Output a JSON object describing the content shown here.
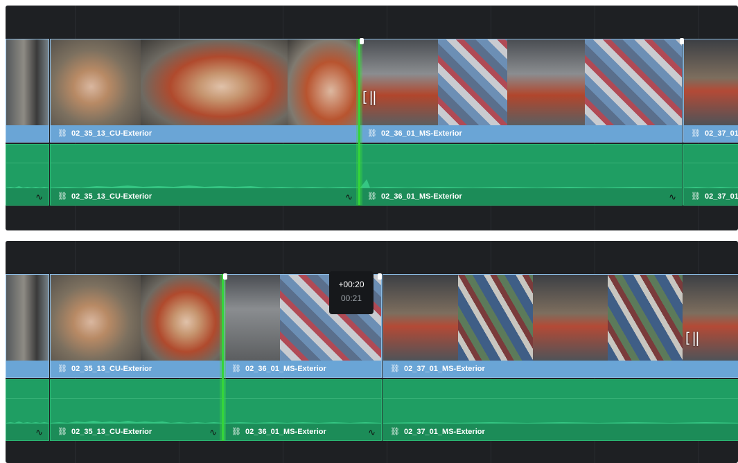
{
  "top_timeline": {
    "video_clips": [
      {
        "name": "",
        "link_icon": "link-icon"
      },
      {
        "name": "02_35_13_CU-Exterior",
        "link_icon": "link-icon"
      },
      {
        "name": "02_36_01_MS-Exterior",
        "link_icon": "link-icon"
      },
      {
        "name": "02_37_01",
        "link_icon": "link-icon"
      }
    ],
    "audio_clips": [
      {
        "name": "",
        "fade": "fade-curve-icon"
      },
      {
        "name": "02_35_13_CU-Exterior",
        "fade": "fade-curve-icon"
      },
      {
        "name": "02_36_01_MS-Exterior",
        "fade": "fade-curve-icon"
      },
      {
        "name": "02_37_01",
        "fade": "fade-curve-icon"
      }
    ],
    "cursor": "trim-cursor-icon"
  },
  "bottom_timeline": {
    "video_clips": [
      {
        "name": "",
        "link_icon": "link-icon"
      },
      {
        "name": "02_35_13_CU-Exterior",
        "link_icon": "link-icon"
      },
      {
        "name": "02_36_01_MS-Exterior",
        "link_icon": "link-icon"
      },
      {
        "name": "02_37_01_MS-Exterior",
        "link_icon": "link-icon"
      }
    ],
    "audio_clips": [
      {
        "name": "",
        "fade": "fade-curve-icon"
      },
      {
        "name": "02_35_13_CU-Exterior",
        "fade": "fade-curve-icon"
      },
      {
        "name": "02_36_01_MS-Exterior",
        "fade": "fade-curve-icon"
      },
      {
        "name": "02_37_01_MS-Exterior",
        "fade": "fade-curve-icon"
      }
    ],
    "tooltip": {
      "offset": "+00:20",
      "duration": "00:21"
    },
    "cursor": "trim-cursor-icon"
  },
  "colors": {
    "timeline_bg": "#1e2023",
    "video_clip": "#6aa5d6",
    "audio_clip": "#1f9e63",
    "edit_point": "#35d43a"
  },
  "glyphs": {
    "link": "⛓",
    "fade": "∿",
    "cursor": "[‖"
  }
}
